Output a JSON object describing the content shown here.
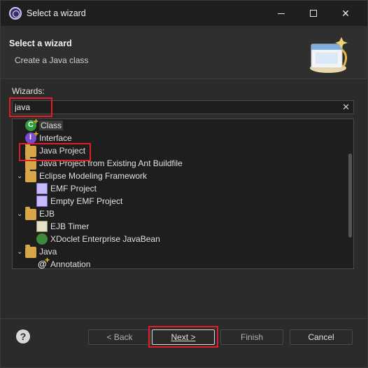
{
  "window": {
    "title": "Select a wizard",
    "min_glyph": "",
    "close_glyph": "✕"
  },
  "header": {
    "title": "Select a wizard",
    "description": "Create a Java class"
  },
  "wizards": {
    "label": "Wizards:",
    "search_value": "java",
    "clear_glyph": "✕"
  },
  "tree": {
    "items": [
      {
        "label": "Class",
        "icon": "class-icon",
        "level": 1,
        "selected": true
      },
      {
        "label": "Interface",
        "icon": "interface-icon",
        "level": 1
      },
      {
        "label": "Java Project",
        "icon": "java-project-icon",
        "level": 1
      },
      {
        "label": "Java Project from Existing Ant Buildfile",
        "icon": "ant-project-icon",
        "level": 1
      },
      {
        "label": "Eclipse Modeling Framework",
        "icon": "folder-icon",
        "level": 0,
        "expanded": true
      },
      {
        "label": "EMF Project",
        "icon": "emf-project-icon",
        "level": 1
      },
      {
        "label": "Empty EMF Project",
        "icon": "emf-project-icon",
        "level": 1
      },
      {
        "label": "EJB",
        "icon": "folder-icon",
        "level": 0,
        "expanded": true
      },
      {
        "label": "EJB Timer",
        "icon": "ejb-timer-icon",
        "level": 1
      },
      {
        "label": "XDoclet Enterprise JavaBean",
        "icon": "xdoclet-icon",
        "level": 1
      },
      {
        "label": "Java",
        "icon": "folder-icon",
        "level": 0,
        "expanded": true
      },
      {
        "label": "Annotation",
        "icon": "annotation-icon",
        "level": 1
      }
    ]
  },
  "footer": {
    "help_glyph": "?",
    "back_label": "< Back",
    "next_label": "Next >",
    "finish_label": "Finish",
    "cancel_label": "Cancel"
  },
  "colors": {
    "highlight": "#e21d2a",
    "background": "#2b2b2b",
    "field_background": "#1e1e1e"
  }
}
